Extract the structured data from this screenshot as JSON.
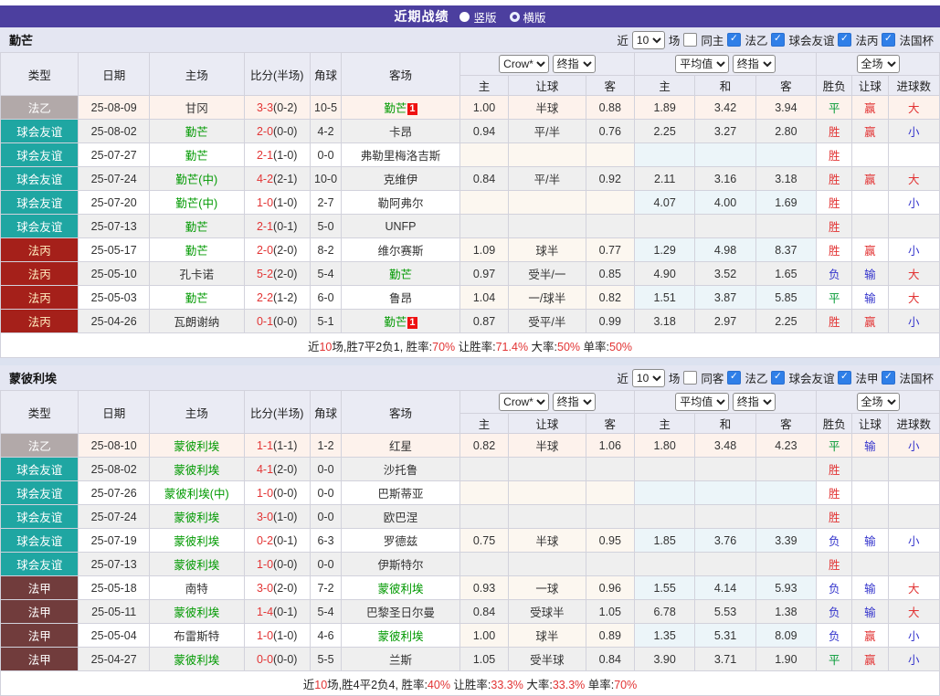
{
  "page": {
    "title": "近期战绩",
    "view_options": [
      {
        "label": "竖版",
        "selected": true
      },
      {
        "label": "横版",
        "selected": false
      }
    ]
  },
  "colors": {
    "topbar": "#4c3f9f",
    "league_fayi": "#b2a9a9",
    "league_friendly": "#1fa6a2",
    "league_fabing": "#a5201a",
    "league_fajia": "#713c3c",
    "focus_team_green": "#009900",
    "score_red": "#e23434",
    "win_red": "#e23434",
    "draw_green": "#009933",
    "lose_blue": "#3434cc",
    "crow_col_bg": "#fcf7f0",
    "avg_col_bg": "#ecf5f9",
    "highlight_row_bg": "#fdf2ec"
  },
  "table_header": {
    "col_type": "类型",
    "col_date": "日期",
    "col_home": "主场",
    "col_score": "比分(半场)",
    "col_corner": "角球",
    "col_away": "客场",
    "odds_source": "Crow*",
    "odds_stage": "终指",
    "avg_source": "平均值",
    "avg_stage": "终指",
    "scope": "全场",
    "sub": [
      "主",
      "让球",
      "客",
      "主",
      "和",
      "客",
      "胜负",
      "让球",
      "进球数"
    ]
  },
  "sections": [
    {
      "team": "勤芒",
      "filter": {
        "recent_label": "近",
        "recent_value": "10",
        "games_label": "场",
        "same_label": "同主",
        "same_checked": false,
        "leagues": [
          {
            "label": "法乙",
            "checked": true
          },
          {
            "label": "球会友谊",
            "checked": true
          },
          {
            "label": "法丙",
            "checked": true
          },
          {
            "label": "法国杯",
            "checked": true
          }
        ]
      },
      "rows": [
        {
          "league": "法乙",
          "league_key": "fayi",
          "date": "25-08-09",
          "home": "甘冈",
          "home_focus": false,
          "score": "3-3",
          "half": "(0-2)",
          "corner": "10-5",
          "away": "勤芒",
          "away_focus": true,
          "away_badge": "1",
          "odds": [
            "1.00",
            "半球",
            "0.88"
          ],
          "avg": [
            "1.89",
            "3.42",
            "3.94"
          ],
          "result": {
            "t": "平",
            "c": "g"
          },
          "handicap": {
            "t": "赢",
            "c": "r"
          },
          "goals": {
            "t": "大",
            "c": "r"
          },
          "highlight": true
        },
        {
          "league": "球会友谊",
          "league_key": "friendly",
          "date": "25-08-02",
          "home": "勤芒",
          "home_focus": true,
          "score": "2-0",
          "half": "(0-0)",
          "corner": "4-2",
          "away": "卡昂",
          "away_focus": false,
          "odds": [
            "0.94",
            "平/半",
            "0.76"
          ],
          "avg": [
            "2.25",
            "3.27",
            "2.80"
          ],
          "result": {
            "t": "胜",
            "c": "r"
          },
          "handicap": {
            "t": "赢",
            "c": "r"
          },
          "goals": {
            "t": "小",
            "c": "b"
          }
        },
        {
          "league": "球会友谊",
          "league_key": "friendly",
          "date": "25-07-27",
          "home": "勤芒",
          "home_focus": true,
          "score": "2-1",
          "half": "(1-0)",
          "corner": "0-0",
          "away": "弗勒里梅洛吉斯",
          "away_focus": false,
          "odds": [
            "",
            "",
            ""
          ],
          "avg": [
            "",
            "",
            ""
          ],
          "result": {
            "t": "胜",
            "c": "r"
          },
          "handicap": {
            "t": "",
            "c": ""
          },
          "goals": {
            "t": "",
            "c": ""
          }
        },
        {
          "league": "球会友谊",
          "league_key": "friendly",
          "date": "25-07-24",
          "home": "勤芒(中)",
          "home_focus": true,
          "score": "4-2",
          "half": "(2-1)",
          "corner": "10-0",
          "away": "克维伊",
          "away_focus": false,
          "odds": [
            "0.84",
            "平/半",
            "0.92"
          ],
          "avg": [
            "2.11",
            "3.16",
            "3.18"
          ],
          "result": {
            "t": "胜",
            "c": "r"
          },
          "handicap": {
            "t": "赢",
            "c": "r"
          },
          "goals": {
            "t": "大",
            "c": "r"
          }
        },
        {
          "league": "球会友谊",
          "league_key": "friendly",
          "date": "25-07-20",
          "home": "勤芒(中)",
          "home_focus": true,
          "score": "1-0",
          "half": "(1-0)",
          "corner": "2-7",
          "away": "勒阿弗尔",
          "away_focus": false,
          "odds": [
            "",
            "",
            ""
          ],
          "avg": [
            "4.07",
            "4.00",
            "1.69"
          ],
          "result": {
            "t": "胜",
            "c": "r"
          },
          "handicap": {
            "t": "",
            "c": ""
          },
          "goals": {
            "t": "小",
            "c": "b"
          }
        },
        {
          "league": "球会友谊",
          "league_key": "friendly",
          "date": "25-07-13",
          "home": "勤芒",
          "home_focus": true,
          "score": "2-1",
          "half": "(0-1)",
          "corner": "5-0",
          "away": "UNFP",
          "away_focus": false,
          "odds": [
            "",
            "",
            ""
          ],
          "avg": [
            "",
            "",
            ""
          ],
          "result": {
            "t": "胜",
            "c": "r"
          },
          "handicap": {
            "t": "",
            "c": ""
          },
          "goals": {
            "t": "",
            "c": ""
          }
        },
        {
          "league": "法丙",
          "league_key": "fabing",
          "date": "25-05-17",
          "home": "勤芒",
          "home_focus": true,
          "score": "2-0",
          "half": "(2-0)",
          "corner": "8-2",
          "away": "维尔赛斯",
          "away_focus": false,
          "odds": [
            "1.09",
            "球半",
            "0.77"
          ],
          "avg": [
            "1.29",
            "4.98",
            "8.37"
          ],
          "result": {
            "t": "胜",
            "c": "r"
          },
          "handicap": {
            "t": "赢",
            "c": "r"
          },
          "goals": {
            "t": "小",
            "c": "b"
          }
        },
        {
          "league": "法丙",
          "league_key": "fabing",
          "date": "25-05-10",
          "home": "孔卡诺",
          "home_focus": false,
          "score": "5-2",
          "half": "(2-0)",
          "corner": "5-4",
          "away": "勤芒",
          "away_focus": true,
          "odds": [
            "0.97",
            "受半/一",
            "0.85"
          ],
          "avg": [
            "4.90",
            "3.52",
            "1.65"
          ],
          "result": {
            "t": "负",
            "c": "b"
          },
          "handicap": {
            "t": "输",
            "c": "b"
          },
          "goals": {
            "t": "大",
            "c": "r"
          }
        },
        {
          "league": "法丙",
          "league_key": "fabing",
          "date": "25-05-03",
          "home": "勤芒",
          "home_focus": true,
          "score": "2-2",
          "half": "(1-2)",
          "corner": "6-0",
          "away": "鲁昂",
          "away_focus": false,
          "odds": [
            "1.04",
            "一/球半",
            "0.82"
          ],
          "avg": [
            "1.51",
            "3.87",
            "5.85"
          ],
          "result": {
            "t": "平",
            "c": "g"
          },
          "handicap": {
            "t": "输",
            "c": "b"
          },
          "goals": {
            "t": "大",
            "c": "r"
          }
        },
        {
          "league": "法丙",
          "league_key": "fabing",
          "date": "25-04-26",
          "home": "瓦朗谢纳",
          "home_focus": false,
          "score": "0-1",
          "half": "(0-0)",
          "corner": "5-1",
          "away": "勤芒",
          "away_focus": true,
          "away_badge": "1",
          "odds": [
            "0.87",
            "受平/半",
            "0.99"
          ],
          "avg": [
            "3.18",
            "2.97",
            "2.25"
          ],
          "result": {
            "t": "胜",
            "c": "r"
          },
          "handicap": {
            "t": "赢",
            "c": "r"
          },
          "goals": {
            "t": "小",
            "c": "b"
          }
        }
      ],
      "summary_segments": [
        {
          "t": "近",
          "r": false
        },
        {
          "t": "10",
          "r": true
        },
        {
          "t": "场,胜7平2负1, 胜率:",
          "r": false
        },
        {
          "t": "70%",
          "r": true
        },
        {
          "t": " 让胜率:",
          "r": false
        },
        {
          "t": "71.4%",
          "r": true
        },
        {
          "t": " 大率:",
          "r": false
        },
        {
          "t": "50%",
          "r": true
        },
        {
          "t": " 单率:",
          "r": false
        },
        {
          "t": "50%",
          "r": true
        }
      ]
    },
    {
      "team": "蒙彼利埃",
      "filter": {
        "recent_label": "近",
        "recent_value": "10",
        "games_label": "场",
        "same_label": "同客",
        "same_checked": false,
        "leagues": [
          {
            "label": "法乙",
            "checked": true
          },
          {
            "label": "球会友谊",
            "checked": true
          },
          {
            "label": "法甲",
            "checked": true
          },
          {
            "label": "法国杯",
            "checked": true
          }
        ]
      },
      "rows": [
        {
          "league": "法乙",
          "league_key": "fayi",
          "date": "25-08-10",
          "home": "蒙彼利埃",
          "home_focus": true,
          "score": "1-1",
          "half": "(1-1)",
          "corner": "1-2",
          "away": "红星",
          "away_focus": false,
          "odds": [
            "0.82",
            "半球",
            "1.06"
          ],
          "avg": [
            "1.80",
            "3.48",
            "4.23"
          ],
          "result": {
            "t": "平",
            "c": "g"
          },
          "handicap": {
            "t": "输",
            "c": "b"
          },
          "goals": {
            "t": "小",
            "c": "b"
          },
          "highlight": true
        },
        {
          "league": "球会友谊",
          "league_key": "friendly",
          "date": "25-08-02",
          "home": "蒙彼利埃",
          "home_focus": true,
          "score": "4-1",
          "half": "(2-0)",
          "corner": "0-0",
          "away": "沙托鲁",
          "away_focus": false,
          "odds": [
            "",
            "",
            ""
          ],
          "avg": [
            "",
            "",
            ""
          ],
          "result": {
            "t": "胜",
            "c": "r"
          },
          "handicap": {
            "t": "",
            "c": ""
          },
          "goals": {
            "t": "",
            "c": ""
          }
        },
        {
          "league": "球会友谊",
          "league_key": "friendly",
          "date": "25-07-26",
          "home": "蒙彼利埃(中)",
          "home_focus": true,
          "score": "1-0",
          "half": "(0-0)",
          "corner": "0-0",
          "away": "巴斯蒂亚",
          "away_focus": false,
          "odds": [
            "",
            "",
            ""
          ],
          "avg": [
            "",
            "",
            ""
          ],
          "result": {
            "t": "胜",
            "c": "r"
          },
          "handicap": {
            "t": "",
            "c": ""
          },
          "goals": {
            "t": "",
            "c": ""
          }
        },
        {
          "league": "球会友谊",
          "league_key": "friendly",
          "date": "25-07-24",
          "home": "蒙彼利埃",
          "home_focus": true,
          "score": "3-0",
          "half": "(1-0)",
          "corner": "0-0",
          "away": "欧巴涅",
          "away_focus": false,
          "odds": [
            "",
            "",
            ""
          ],
          "avg": [
            "",
            "",
            ""
          ],
          "result": {
            "t": "胜",
            "c": "r"
          },
          "handicap": {
            "t": "",
            "c": ""
          },
          "goals": {
            "t": "",
            "c": ""
          }
        },
        {
          "league": "球会友谊",
          "league_key": "friendly",
          "date": "25-07-19",
          "home": "蒙彼利埃",
          "home_focus": true,
          "score": "0-2",
          "half": "(0-1)",
          "corner": "6-3",
          "away": "罗德兹",
          "away_focus": false,
          "odds": [
            "0.75",
            "半球",
            "0.95"
          ],
          "avg": [
            "1.85",
            "3.76",
            "3.39"
          ],
          "result": {
            "t": "负",
            "c": "b"
          },
          "handicap": {
            "t": "输",
            "c": "b"
          },
          "goals": {
            "t": "小",
            "c": "b"
          }
        },
        {
          "league": "球会友谊",
          "league_key": "friendly",
          "date": "25-07-13",
          "home": "蒙彼利埃",
          "home_focus": true,
          "score": "1-0",
          "half": "(0-0)",
          "corner": "0-0",
          "away": "伊斯特尔",
          "away_focus": false,
          "odds": [
            "",
            "",
            ""
          ],
          "avg": [
            "",
            "",
            ""
          ],
          "result": {
            "t": "胜",
            "c": "r"
          },
          "handicap": {
            "t": "",
            "c": ""
          },
          "goals": {
            "t": "",
            "c": ""
          }
        },
        {
          "league": "法甲",
          "league_key": "fajia",
          "date": "25-05-18",
          "home": "南特",
          "home_focus": false,
          "score": "3-0",
          "half": "(2-0)",
          "corner": "7-2",
          "away": "蒙彼利埃",
          "away_focus": true,
          "odds": [
            "0.93",
            "一球",
            "0.96"
          ],
          "avg": [
            "1.55",
            "4.14",
            "5.93"
          ],
          "result": {
            "t": "负",
            "c": "b"
          },
          "handicap": {
            "t": "输",
            "c": "b"
          },
          "goals": {
            "t": "大",
            "c": "r"
          }
        },
        {
          "league": "法甲",
          "league_key": "fajia",
          "date": "25-05-11",
          "home": "蒙彼利埃",
          "home_focus": true,
          "score": "1-4",
          "half": "(0-1)",
          "corner": "5-4",
          "away": "巴黎圣日尔曼",
          "away_focus": false,
          "odds": [
            "0.84",
            "受球半",
            "1.05"
          ],
          "avg": [
            "6.78",
            "5.53",
            "1.38"
          ],
          "result": {
            "t": "负",
            "c": "b"
          },
          "handicap": {
            "t": "输",
            "c": "b"
          },
          "goals": {
            "t": "大",
            "c": "r"
          }
        },
        {
          "league": "法甲",
          "league_key": "fajia",
          "date": "25-05-04",
          "home": "布雷斯特",
          "home_focus": false,
          "score": "1-0",
          "half": "(1-0)",
          "corner": "4-6",
          "away": "蒙彼利埃",
          "away_focus": true,
          "odds": [
            "1.00",
            "球半",
            "0.89"
          ],
          "avg": [
            "1.35",
            "5.31",
            "8.09"
          ],
          "result": {
            "t": "负",
            "c": "b"
          },
          "handicap": {
            "t": "赢",
            "c": "r"
          },
          "goals": {
            "t": "小",
            "c": "b"
          }
        },
        {
          "league": "法甲",
          "league_key": "fajia",
          "date": "25-04-27",
          "home": "蒙彼利埃",
          "home_focus": true,
          "score": "0-0",
          "half": "(0-0)",
          "corner": "5-5",
          "away": "兰斯",
          "away_focus": false,
          "odds": [
            "1.05",
            "受半球",
            "0.84"
          ],
          "avg": [
            "3.90",
            "3.71",
            "1.90"
          ],
          "result": {
            "t": "平",
            "c": "g"
          },
          "handicap": {
            "t": "赢",
            "c": "r"
          },
          "goals": {
            "t": "小",
            "c": "b"
          }
        }
      ],
      "summary_segments": [
        {
          "t": "近",
          "r": false
        },
        {
          "t": "10",
          "r": true
        },
        {
          "t": "场,胜4平2负4, 胜率:",
          "r": false
        },
        {
          "t": "40%",
          "r": true
        },
        {
          "t": " 让胜率:",
          "r": false
        },
        {
          "t": "33.3%",
          "r": true
        },
        {
          "t": " 大率:",
          "r": false
        },
        {
          "t": "33.3%",
          "r": true
        },
        {
          "t": " 单率:",
          "r": false
        },
        {
          "t": "70%",
          "r": true
        }
      ]
    }
  ]
}
